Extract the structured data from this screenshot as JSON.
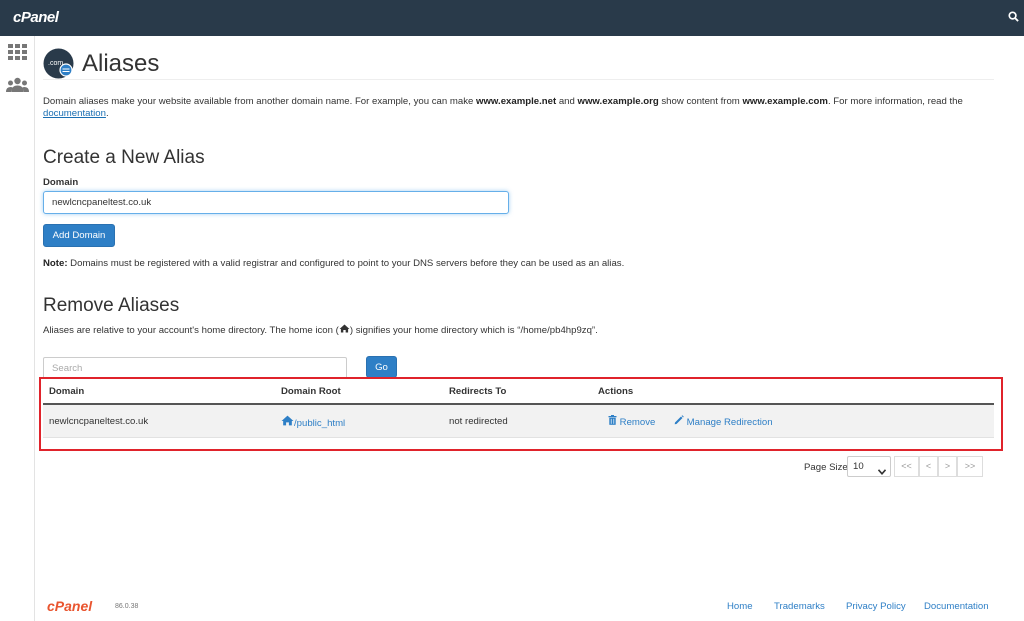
{
  "header": {
    "logo_text": "cPanel",
    "search_icon": "search-icon"
  },
  "sidebar": {
    "items": [
      {
        "icon": "grid-icon"
      },
      {
        "icon": "users-icon"
      }
    ]
  },
  "page": {
    "title": "Aliases",
    "intro_part1": "Domain aliases make your website available from another domain name. For example, you can make ",
    "intro_ex1": "www.example.net",
    "intro_and": " and ",
    "intro_ex2": "www.example.org",
    "intro_part2": " show content from ",
    "intro_ex3": "www.example.com",
    "intro_part3": ". For more information, read the",
    "intro_link": "documentation",
    "intro_end": "."
  },
  "create": {
    "heading": "Create a New Alias",
    "domain_label": "Domain",
    "domain_value": "newlcncpaneltest.co.uk",
    "add_button": "Add Domain",
    "note_label": "Note:",
    "note_text": " Domains must be registered with a valid registrar and configured to point to your DNS servers before they can be used as an alias."
  },
  "remove": {
    "heading": "Remove Aliases",
    "desc_part1": "Aliases are relative to your account's home directory. The home icon (",
    "desc_part2": ") signifies your home directory which is “/home/pb4hp9zq”.",
    "search_placeholder": "Search",
    "go_button": "Go",
    "columns": [
      "Domain",
      "Domain Root",
      "Redirects To",
      "Actions"
    ],
    "rows": [
      {
        "domain": "newlcncpaneltest.co.uk",
        "root": "/public_html",
        "redirects": "not redirected",
        "remove_label": "Remove",
        "manage_label": "Manage Redirection"
      }
    ]
  },
  "pagination": {
    "page_size_label": "Page Size",
    "page_size_value": "10",
    "first": "<<",
    "prev": "<",
    "next": ">",
    "last": ">>"
  },
  "footer": {
    "logo_text": "cPanel",
    "version": "86.0.38",
    "links": [
      "Home",
      "Trademarks",
      "Privacy Policy",
      "Documentation"
    ]
  },
  "colors": {
    "topbar": "#293a4a",
    "accent": "#2e7fc6",
    "highlight_border": "#e0232b",
    "footer_logo": "#e9552f"
  }
}
